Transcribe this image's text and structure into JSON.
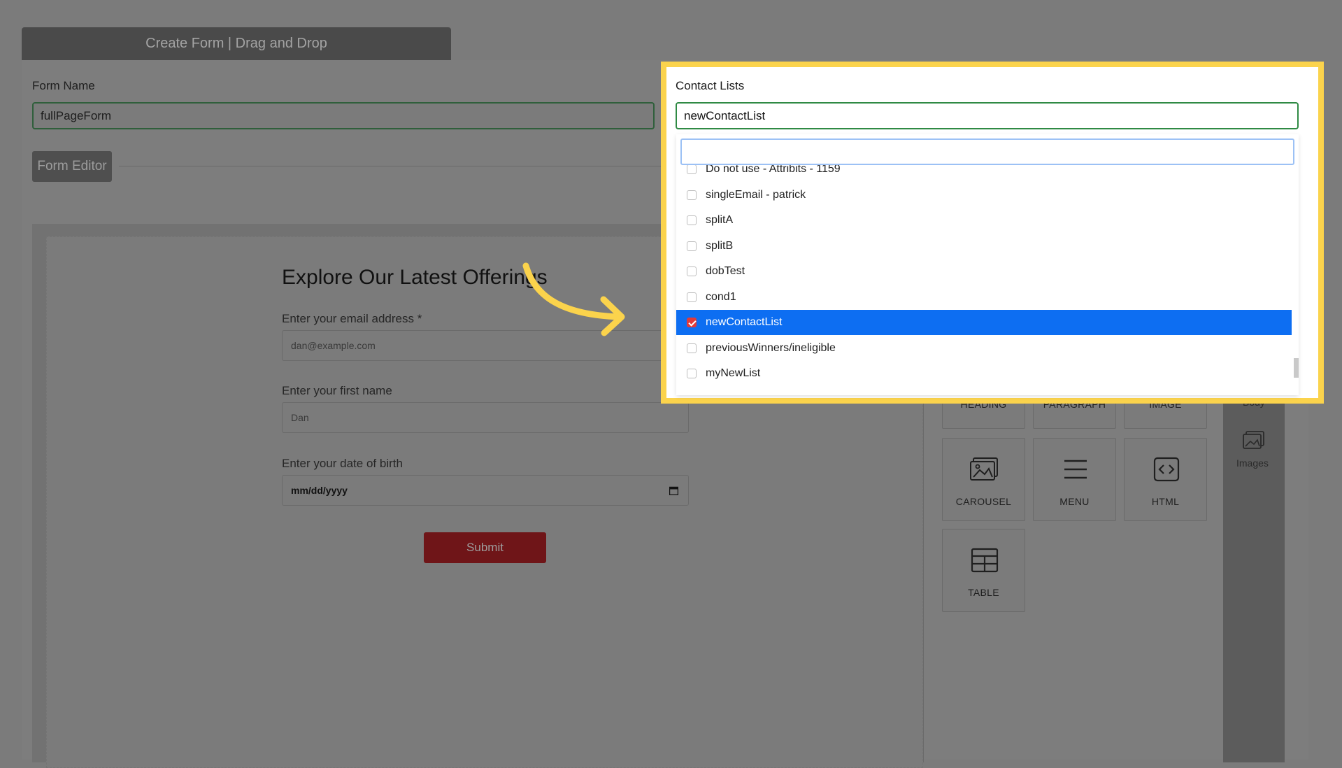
{
  "header": {
    "title": "Create Form | Drag and Drop"
  },
  "form_name": {
    "label": "Form Name",
    "value": "fullPageForm"
  },
  "editor": {
    "button_label": "Form Editor"
  },
  "form_preview": {
    "title": "Explore Our Latest Offerings",
    "email": {
      "label": "Enter your email address *",
      "placeholder": "dan@example.com"
    },
    "first_name": {
      "label": "Enter your first name",
      "placeholder": "Dan"
    },
    "dob": {
      "label": "Enter your date of birth",
      "placeholder": "mm/dd/yyyy"
    },
    "submit_label": "Submit"
  },
  "blocks": [
    {
      "label": "HEADING",
      "icon": "heading-icon"
    },
    {
      "label": "PARAGRAPH",
      "icon": "paragraph-icon"
    },
    {
      "label": "IMAGE",
      "icon": "image-icon"
    },
    {
      "label": "CAROUSEL",
      "icon": "carousel-icon"
    },
    {
      "label": "MENU",
      "icon": "menu-icon"
    },
    {
      "label": "HTML",
      "icon": "html-icon"
    },
    {
      "label": "TABLE",
      "icon": "table-icon"
    }
  ],
  "side_panel": {
    "body_label": "Body",
    "images_label": "Images"
  },
  "contact_lists": {
    "label": "Contact Lists",
    "value": "newContactList",
    "search_value": "",
    "options": [
      {
        "label": "Do not use - Attribits - 1159",
        "checked": false
      },
      {
        "label": "singleEmail - patrick",
        "checked": false
      },
      {
        "label": "splitA",
        "checked": false
      },
      {
        "label": "splitB",
        "checked": false
      },
      {
        "label": "dobTest",
        "checked": false
      },
      {
        "label": "cond1",
        "checked": false
      },
      {
        "label": "newContactList",
        "checked": true
      },
      {
        "label": "previousWinners/ineligible",
        "checked": false
      },
      {
        "label": "myNewList",
        "checked": false
      }
    ]
  },
  "colors": {
    "highlight": "#fbd34c",
    "selected_option": "#0d6ef2",
    "checkbox_checked": "#e23a3a",
    "submit_button": "#6f1518",
    "input_border": "#2f8a44"
  }
}
